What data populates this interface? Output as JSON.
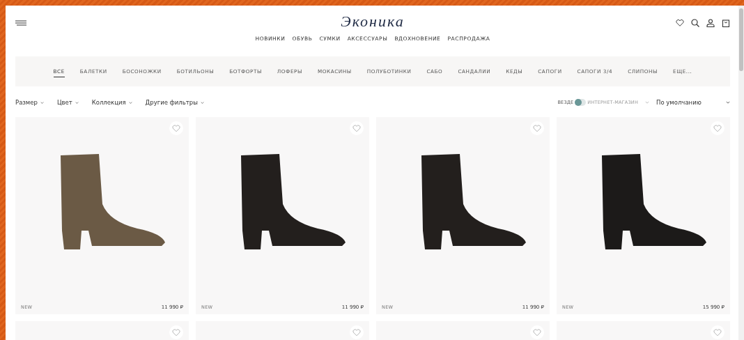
{
  "header": {
    "logo": "Эконика",
    "nav": [
      "НОВИНКИ",
      "ОБУВЬ",
      "СУМКИ",
      "АКСЕССУАРЫ",
      "ВДОХНОВЕНИЕ",
      "РАСПРОДАЖА"
    ]
  },
  "categories": [
    {
      "label": "ВСЕ",
      "selected": true
    },
    {
      "label": "БАЛЕТКИ",
      "selected": false
    },
    {
      "label": "БОСОНОЖКИ",
      "selected": false
    },
    {
      "label": "БОТИЛЬОНЫ",
      "selected": false
    },
    {
      "label": "БОТФОРТЫ",
      "selected": false
    },
    {
      "label": "ЛОФЕРЫ",
      "selected": false
    },
    {
      "label": "МОКАСИНЫ",
      "selected": false
    },
    {
      "label": "ПОЛУБОТИНКИ",
      "selected": false
    },
    {
      "label": "САБО",
      "selected": false
    },
    {
      "label": "САНДАЛИИ",
      "selected": false
    },
    {
      "label": "КЕДЫ",
      "selected": false
    },
    {
      "label": "САПОГИ",
      "selected": false
    },
    {
      "label": "САПОГИ 3/4",
      "selected": false
    },
    {
      "label": "СЛИПОНЫ",
      "selected": false
    },
    {
      "label": "ЕЩЕ...",
      "selected": false
    }
  ],
  "filters": [
    "Размер",
    "Цвет",
    "Коллекция",
    "Другие фильтры"
  ],
  "availability": {
    "left": "ВЕЗДЕ",
    "right": "ИНТЕРНЕТ-МАГАЗИН",
    "on": false
  },
  "sort": {
    "value": "По умолчанию"
  },
  "products": [
    {
      "badge": "NEW",
      "price": "11 990 ₽",
      "color": "#6b5a45",
      "favorite": false
    },
    {
      "badge": "NEW",
      "price": "11 990 ₽",
      "color": "#231f1d",
      "favorite": false
    },
    {
      "badge": "NEW",
      "price": "11 990 ₽",
      "color": "#231f1d",
      "favorite": false
    },
    {
      "badge": "NEW",
      "price": "15 990 ₽",
      "color": "#1c1a19",
      "favorite": false
    },
    {
      "favorite": false
    },
    {
      "favorite": false
    },
    {
      "favorite": false
    },
    {
      "favorite": false
    }
  ]
}
